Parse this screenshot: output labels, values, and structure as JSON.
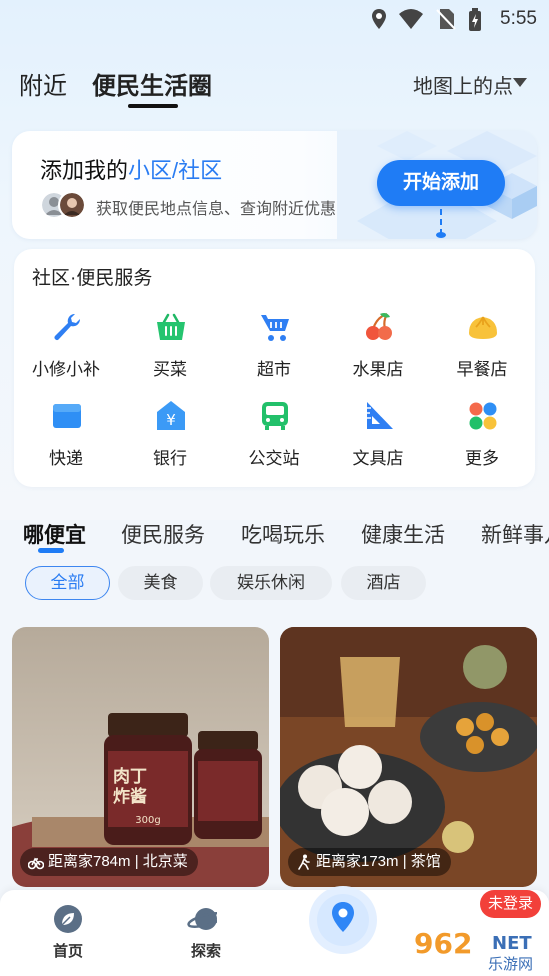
{
  "status_bar": {
    "time": "5:55"
  },
  "top_nav": {
    "tabs": [
      {
        "label": "附近"
      },
      {
        "label": "便民生活圈"
      }
    ],
    "map_dropdown": "地图上的点"
  },
  "add_card": {
    "title_prefix": "添加我的",
    "title_highlight": "小区/社区",
    "subtitle": "获取便民地点信息、查询附近优惠",
    "button": "开始添加"
  },
  "services": {
    "title": "社区·便民服务",
    "items": [
      {
        "label": "小修小补",
        "icon": "wrench-icon"
      },
      {
        "label": "买菜",
        "icon": "basket-icon"
      },
      {
        "label": "超市",
        "icon": "cart-icon"
      },
      {
        "label": "水果店",
        "icon": "cherry-icon"
      },
      {
        "label": "早餐店",
        "icon": "bun-icon"
      },
      {
        "label": "快递",
        "icon": "package-icon"
      },
      {
        "label": "银行",
        "icon": "bank-icon"
      },
      {
        "label": "公交站",
        "icon": "bus-icon"
      },
      {
        "label": "文具店",
        "icon": "ruler-icon"
      },
      {
        "label": "更多",
        "icon": "more-grid-icon"
      }
    ]
  },
  "category_tabs": [
    "哪便宜",
    "便民服务",
    "吃喝玩乐",
    "健康生活",
    "新鲜事儿"
  ],
  "filter_chips": [
    "全部",
    "美食",
    "娱乐休闲",
    "酒店"
  ],
  "feed": [
    {
      "distance": "距离家784m",
      "category": "北京菜",
      "photo_label_1": "肉丁",
      "photo_label_2": "炸酱",
      "photo_label_3": "300g",
      "mode": "bike-icon"
    },
    {
      "distance": "距离家173m",
      "category": "茶馆",
      "mode": "walk-icon"
    }
  ],
  "bottom_nav": [
    {
      "label": "首页",
      "icon": "leaf-icon"
    },
    {
      "label": "探索",
      "icon": "planet-icon"
    }
  ],
  "login_badge": "未登录",
  "watermark": {
    "line1": "962",
    "line2": "NET",
    "line3": "乐游网"
  },
  "colors": {
    "accent": "#1f7cf5",
    "badge": "#f2403a"
  }
}
